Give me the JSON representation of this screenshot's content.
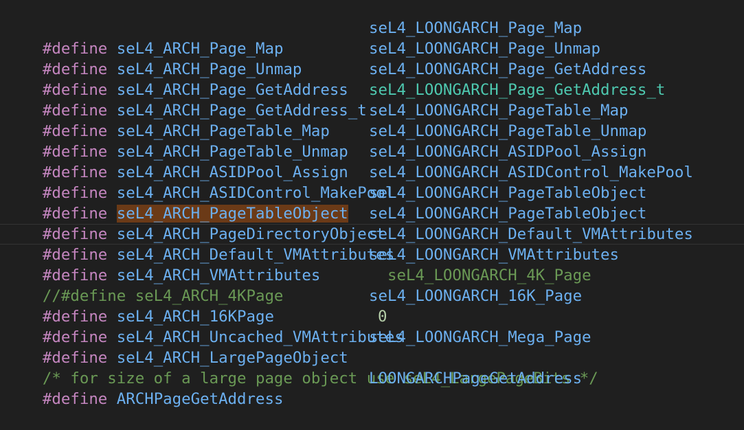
{
  "editor": {
    "lines": [
      {
        "prefix": "#define",
        "name": "seL4_ARCH_Page_Map",
        "value": "seL4_LOONGARCH_Page_Map"
      },
      {
        "prefix": "#define",
        "name": "seL4_ARCH_Page_Unmap",
        "value": "seL4_LOONGARCH_Page_Unmap"
      },
      {
        "prefix": "#define",
        "name": "seL4_ARCH_Page_GetAddress",
        "value": "seL4_LOONGARCH_Page_GetAddress"
      },
      {
        "prefix": "#define",
        "name": "seL4_ARCH_Page_GetAddress_t",
        "value": "seL4_LOONGARCH_Page_GetAddress_t"
      },
      {
        "prefix": "#define",
        "name": "seL4_ARCH_PageTable_Map",
        "value": "seL4_LOONGARCH_PageTable_Map"
      },
      {
        "prefix": "#define",
        "name": "seL4_ARCH_PageTable_Unmap",
        "value": "seL4_LOONGARCH_PageTable_Unmap"
      },
      {
        "prefix": "#define",
        "name": "seL4_ARCH_ASIDPool_Assign",
        "value": "seL4_LOONGARCH_ASIDPool_Assign"
      },
      {
        "prefix": "#define",
        "name": "seL4_ARCH_ASIDControl_MakePool",
        "value": "seL4_LOONGARCH_ASIDControl_MakePool"
      },
      {
        "prefix": "#define",
        "name": "seL4_ARCH_PageTableObject",
        "value": "seL4_LOONGARCH_PageTableObject"
      },
      {
        "prefix": "#define",
        "name": "seL4_ARCH_PageDirectoryObject",
        "value": "seL4_LOONGARCH_PageTableObject"
      },
      {
        "prefix": "#define",
        "name": "seL4_ARCH_Default_VMAttributes",
        "value": "seL4_LOONGARCH_Default_VMAttributes"
      },
      {
        "prefix": "#define",
        "name": "seL4_ARCH_VMAttributes",
        "value": "seL4_LOONGARCH_VMAttributes"
      },
      {
        "comment_prefix": "//#define seL4_ARCH_4KPage",
        "value": "seL4_LOONGARCH_4K_Page"
      },
      {
        "prefix": "#define",
        "name": "seL4_ARCH_16KPage",
        "value": "seL4_LOONGARCH_16K_Page"
      },
      {
        "prefix": "#define",
        "name": "seL4_ARCH_Uncached_VMAttributes",
        "value": "0"
      },
      {
        "prefix": "#define",
        "name": "seL4_ARCH_LargePageObject",
        "value": "seL4_LOONGARCH_Mega_Page"
      },
      {
        "comment_text": "/* for size of a large page object use seL4_LargePageBits */"
      },
      {
        "prefix": "#define",
        "name": "ARCHPageGetAddress",
        "value": "LOONGARCHPageGetAddress"
      }
    ]
  },
  "colors": {
    "background": "#1f1f1f",
    "keyword": "#c586c0",
    "identifier": "#6cb0f0",
    "highlighted_value": "#4ec9b0",
    "number": "#b5cea8",
    "comment": "#6a9955",
    "selection": "#6b3a17"
  }
}
